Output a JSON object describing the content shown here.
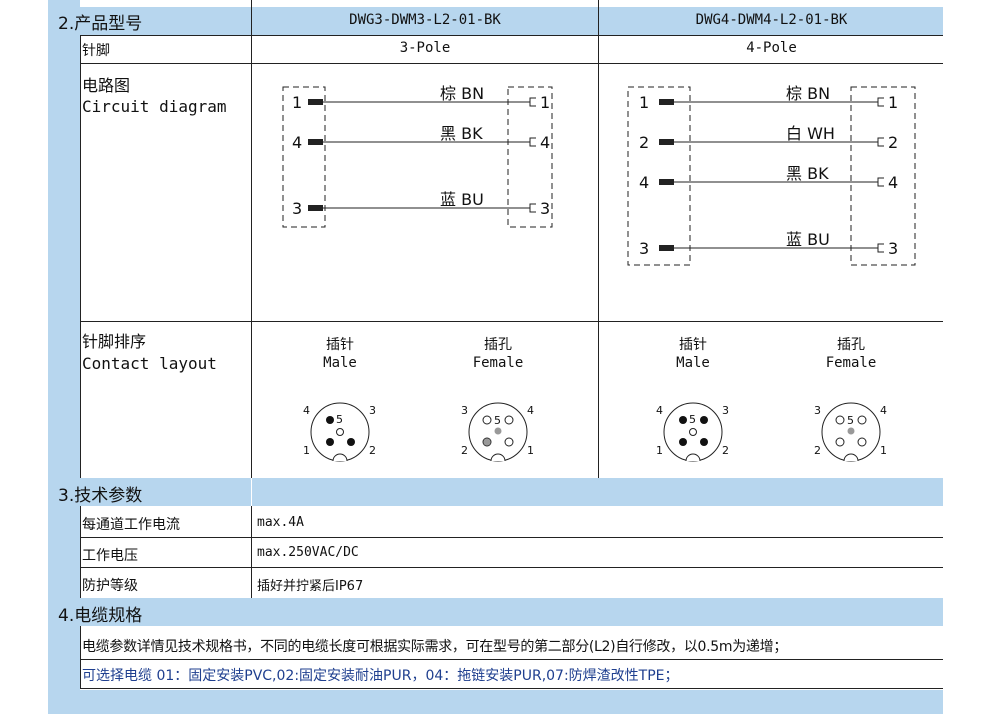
{
  "section2": {
    "title": "2.产品型号",
    "models": [
      "DWG3-DWM3-L2-01-BK",
      "DWG4-DWM4-L2-01-BK"
    ],
    "pin_label": "针脚",
    "poles": [
      "3-Pole",
      "4-Pole"
    ],
    "circuit_label_cn": "电路图",
    "circuit_label_en": "Circuit diagram",
    "contact_label_cn": "针脚排序",
    "contact_label_en": "Contact layout"
  },
  "circuit3": {
    "wires": [
      {
        "pin": "1",
        "color": "棕 BN"
      },
      {
        "pin": "4",
        "color": "黑 BK"
      },
      {
        "pin": "3",
        "color": "蓝 BU"
      }
    ]
  },
  "circuit4": {
    "wires": [
      {
        "pin": "1",
        "color": "棕 BN"
      },
      {
        "pin": "2",
        "color": "白 WH"
      },
      {
        "pin": "4",
        "color": "黑 BK"
      },
      {
        "pin": "3",
        "color": "蓝 BU"
      }
    ]
  },
  "contact": {
    "male_cn": "插针",
    "male_en": "Male",
    "female_cn": "插孔",
    "female_en": "Female",
    "pin_numbers": {
      "p1": "1",
      "p2": "2",
      "p3": "3",
      "p4": "4",
      "p5": "5"
    }
  },
  "section3": {
    "title": "3.技术参数",
    "rows": [
      {
        "label": "每通道工作电流",
        "value": "max.4A"
      },
      {
        "label": "工作电压",
        "value": "max.250VAC/DC"
      },
      {
        "label": "防护等级",
        "value": "插好并拧紧后IP67"
      }
    ]
  },
  "section4": {
    "title": "4.电缆规格",
    "line1": "电缆参数详情见技术规格书，不同的电缆长度可根据实际需求，可在型号的第二部分(L2)自行修改，以0.5m为递增；",
    "line2": "可选择电缆 01：固定安装PVC,02:固定安装耐油PUR，04：拖链安装PUR,07:防焊渣改性TPE；"
  },
  "colors": {
    "band": "#b7d6ee",
    "link_blue": "#1f3f8f"
  }
}
